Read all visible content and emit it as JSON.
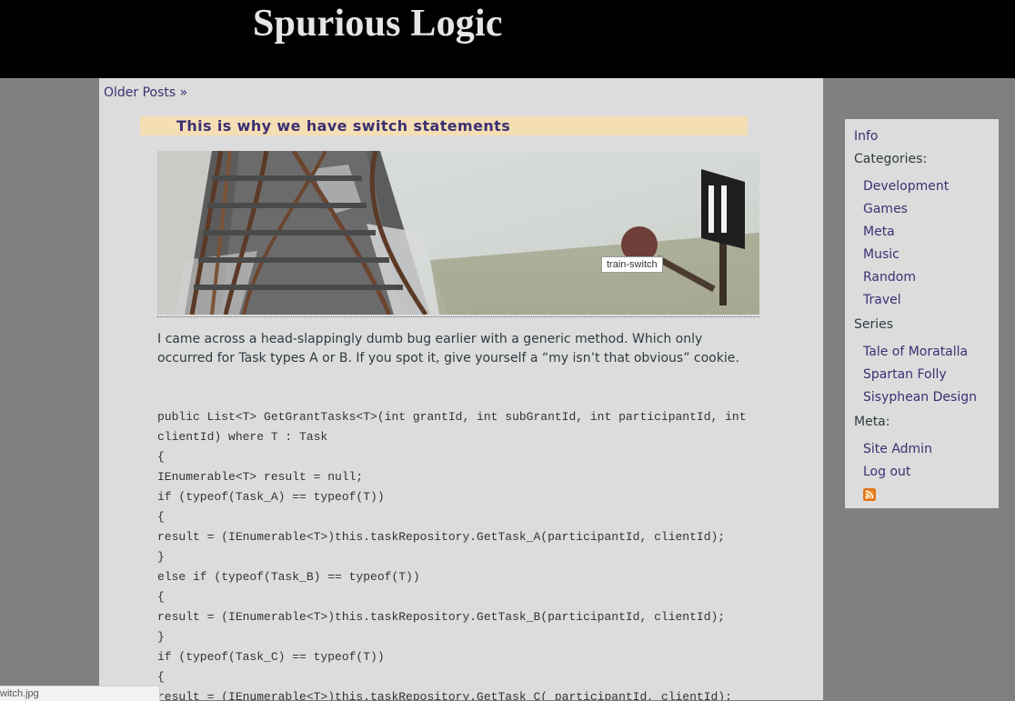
{
  "site": {
    "title": "Spurious Logic"
  },
  "nav": {
    "older_posts": "Older Posts »"
  },
  "post": {
    "title": "This is why we have switch statements",
    "image_tooltip": "train-switch",
    "intro": "I came across a head-slappingly dumb bug earlier with a generic method. Which only occurred for Task types A or B. If you spot it, give yourself a “my isn’t that obvious” cookie.",
    "code_lines": [
      "public List<T> GetGrantTasks<T>(int grantId, int subGrantId, int participantId, int",
      "clientId) where T : Task",
      "{",
      "IEnumerable<T> result = null;",
      "if (typeof(Task_A) == typeof(T))",
      "{",
      "result = (IEnumerable<T>)this.taskRepository.GetTask_A(participantId, clientId);",
      "}",
      "else if (typeof(Task_B) == typeof(T))",
      "{",
      "result = (IEnumerable<T>)this.taskRepository.GetTask_B(participantId, clientId);",
      "}",
      "if (typeof(Task_C) == typeof(T))",
      "{",
      "result = (IEnumerable<T>)this.taskRepository.GetTask_C( participantId, clientId);"
    ]
  },
  "sidebar": {
    "info": "Info",
    "categories_heading": "Categories:",
    "categories": [
      "Development",
      "Games",
      "Meta",
      "Music",
      "Random",
      "Travel"
    ],
    "series_heading": "Series",
    "series": [
      "Tale of Moratalla",
      "Spartan Folly",
      "Sisyphean Design"
    ],
    "meta_heading": "Meta:",
    "meta_links": [
      "Site Admin",
      "Log out"
    ],
    "rss_icon": "rss-icon"
  },
  "status_bar": {
    "text": "witch.jpg"
  }
}
